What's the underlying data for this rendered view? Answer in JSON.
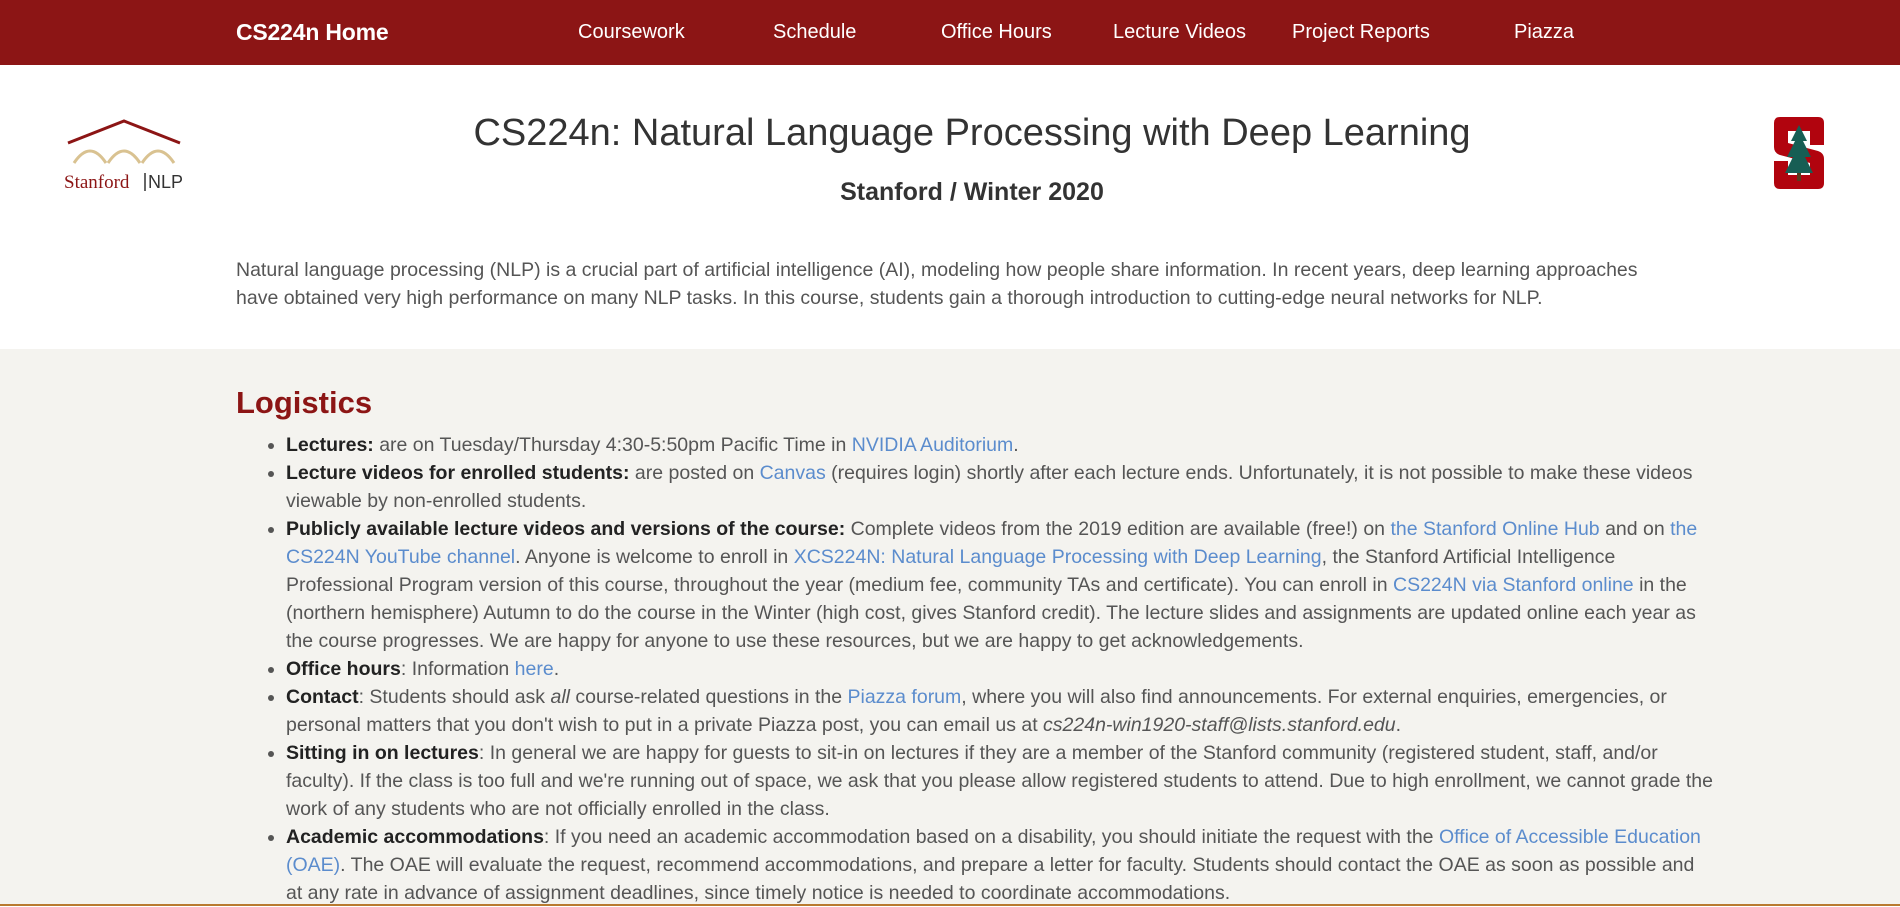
{
  "nav": {
    "brand": "CS224n Home",
    "links": [
      "Coursework",
      "Schedule",
      "Office Hours",
      "Lecture Videos",
      "Project Reports",
      "Piazza"
    ]
  },
  "header": {
    "logo_left_text": "Stanford",
    "logo_left_text2": "NLP",
    "title": "CS224n: Natural Language Processing with Deep Learning",
    "subtitle": "Stanford / Winter 2020",
    "intro": "Natural language processing (NLP) is a crucial part of artificial intelligence (AI), modeling how people share information. In recent years, deep learning approaches have obtained very high performance on many NLP tasks. In this course, students gain a thorough introduction to cutting-edge neural networks for NLP."
  },
  "logistics": {
    "heading": "Logistics",
    "lectures": {
      "label": "Lectures:",
      "text1": " are on Tuesday/Thursday 4:30-5:50pm Pacific Time in ",
      "link1": "NVIDIA Auditorium",
      "text2": "."
    },
    "videos_enrolled": {
      "label": "Lecture videos for enrolled students:",
      "text1": " are posted on ",
      "link1": "Canvas",
      "text2": " (requires login) shortly after each lecture ends. Unfortunately, it is not possible to make these videos viewable by non-enrolled students."
    },
    "public_videos": {
      "label": "Publicly available lecture videos and versions of the course:",
      "text1": " Complete videos from the 2019 edition are available (free!) on ",
      "link1": "the Stanford Online Hub",
      "text2": " and on ",
      "link2": "the CS224N YouTube channel",
      "text3": ". Anyone is welcome to enroll in ",
      "link3": "XCS224N: Natural Language Processing with Deep Learning",
      "text4": ", the Stanford Artificial Intelligence Professional Program version of this course, throughout the year (medium fee, community TAs and certificate). You can enroll in ",
      "link4": "CS224N via Stanford online",
      "text5": " in the (northern hemisphere) Autumn to do the course in the Winter (high cost, gives Stanford credit). The lecture slides and assignments are updated online each year as the course progresses. We are happy for anyone to use these resources, but we are happy to get acknowledgements."
    },
    "office_hours": {
      "label": "Office hours",
      "text1": ": Information ",
      "link1": "here",
      "text2": "."
    },
    "contact": {
      "label": "Contact",
      "text1": ": Students should ask ",
      "em1": "all",
      "text2": " course-related questions in the ",
      "link1": "Piazza forum",
      "text3": ", where you will also find announcements. For external enquiries, emergencies, or personal matters that you don't wish to put in a private Piazza post, you can email us at ",
      "em2": "cs224n-win1920-staff@lists.stanford.edu",
      "text4": "."
    },
    "sitting_in": {
      "label": "Sitting in on lectures",
      "text1": ": In general we are happy for guests to sit-in on lectures if they are a member of the Stanford community (registered student, staff, and/or faculty). If the class is too full and we're running out of space, we ask that you please allow registered students to attend. Due to high enrollment, we cannot grade the work of any students who are not officially enrolled in the class."
    },
    "accommodations": {
      "label": "Academic accommodations",
      "text1": ": If you need an academic accommodation based on a disability, you should initiate the request with the ",
      "link1": "Office of Accessible Education (OAE)",
      "text2": ". The OAE will evaluate the request, recommend accommodations, and prepare a letter for faculty. Students should contact the OAE as soon as possible and at any rate in advance of assignment deadlines, since timely notice is needed to coordinate accommodations."
    }
  },
  "colors": {
    "cardinal": "#8c1515",
    "link": "#5b8ccd",
    "section_bg": "#f4f3ef"
  }
}
